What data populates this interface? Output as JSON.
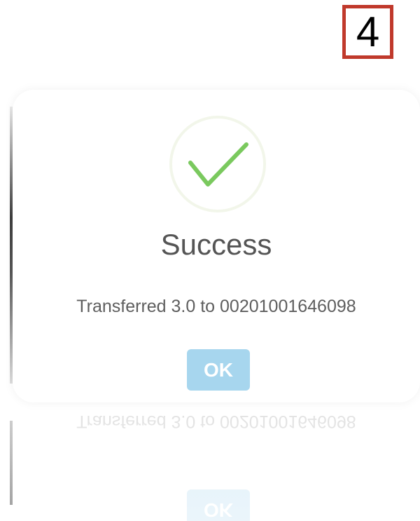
{
  "step_badge": {
    "number": "4",
    "border_color": "#c0392b"
  },
  "dialog": {
    "icon": "checkmark-icon",
    "icon_color": "#7ac95e",
    "title": "Success",
    "message": "Transferred 3.0 to 00201001646098",
    "ok_label": "OK",
    "ok_color": "#a7d6ee"
  }
}
